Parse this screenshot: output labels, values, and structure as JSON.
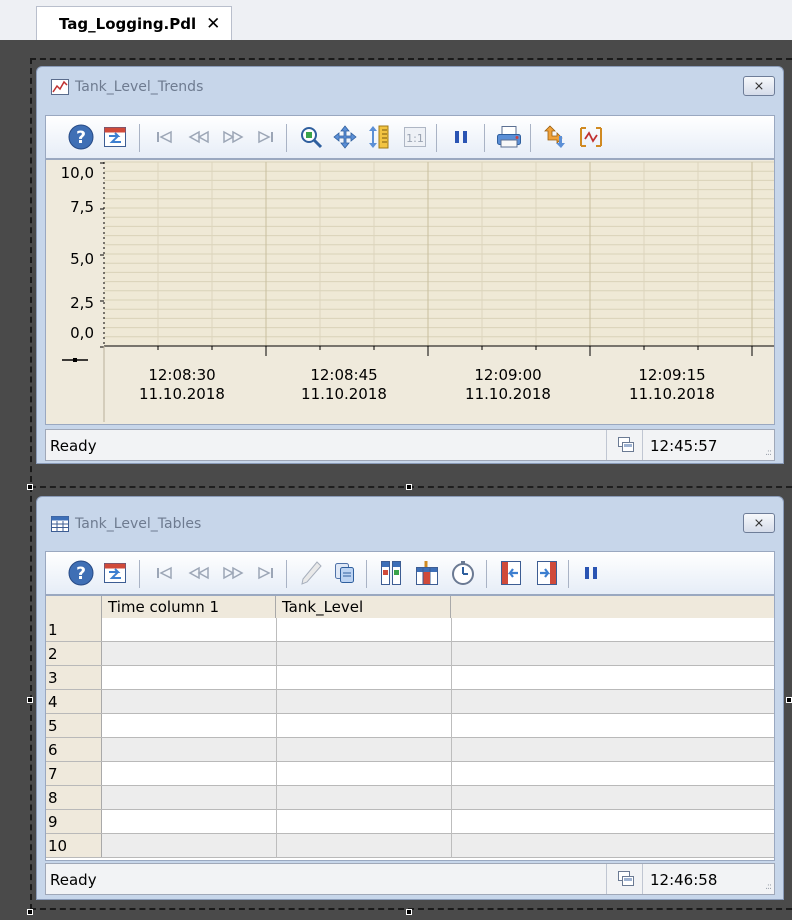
{
  "tab": {
    "label": "Tag_Logging.Pdl",
    "close": "✕"
  },
  "trend_control": {
    "title": "Tank_Level_Trends",
    "close_icon": "window-close-icon",
    "toolbar": [
      "help-icon",
      "configure-dialog-icon",
      "first-data-record-icon",
      "previous-data-record-icon",
      "next-data-record-icon",
      "last-data-record-icon",
      "zoom-area-icon",
      "move-trend-area-icon",
      "zoom-time-axis-icon",
      "original-view-icon",
      "stop-icon",
      "print-icon",
      "select-statistic-area-icon",
      "ruler-icon"
    ],
    "status": {
      "text": "Ready",
      "time": "12:45:57",
      "icon": "connection-status-icon"
    }
  },
  "chart_data": {
    "type": "line",
    "title": "",
    "ylim": [
      0,
      10
    ],
    "yticks": [
      "10,0",
      "7,5",
      "5,0",
      "2,5",
      "0,0"
    ],
    "xticks": [
      {
        "time": "12:08:30",
        "date": "11.10.2018"
      },
      {
        "time": "12:08:45",
        "date": "11.10.2018"
      },
      {
        "time": "12:09:00",
        "date": "11.10.2018"
      },
      {
        "time": "12:09:15",
        "date": "11.10.2018"
      }
    ],
    "grid": true,
    "series": []
  },
  "table_control": {
    "title": "Tank_Level_Tables",
    "close_icon": "window-close-icon",
    "toolbar": [
      "help-icon",
      "configure-dialog-icon",
      "first-data-record-icon",
      "previous-data-record-icon",
      "next-data-record-icon",
      "last-data-record-icon",
      "edit-icon",
      "copy-rows-icon",
      "select-columns-icon",
      "select-data-connection-icon",
      "time-range-icon",
      "previous-column-icon",
      "next-column-icon",
      "stop-icon"
    ],
    "columns": [
      "Time column 1",
      "Tank_Level"
    ],
    "rows": [
      "1",
      "2",
      "3",
      "4",
      "5",
      "6",
      "7",
      "8",
      "9",
      "10"
    ],
    "status": {
      "text": "Ready",
      "time": "12:46:58",
      "icon": "connection-status-icon"
    }
  }
}
